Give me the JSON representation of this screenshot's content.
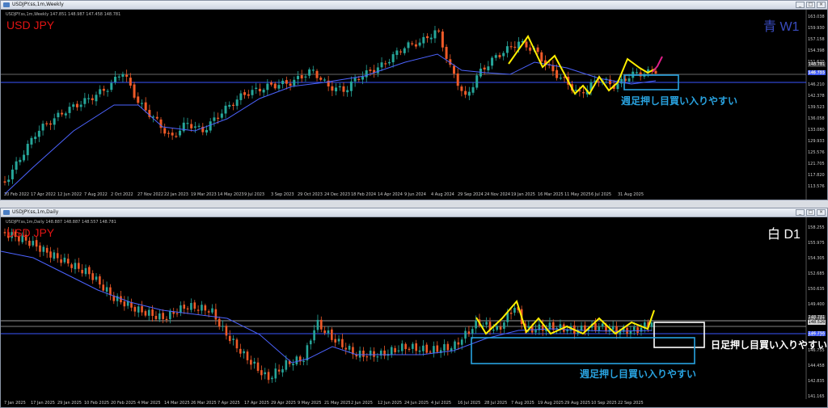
{
  "colors": {
    "bull": "#26a69a",
    "bear": "#ef5a28",
    "ma": "#4c63ff",
    "zigzag": "#ffef00",
    "pink": "#e01f8a",
    "cyan": "#29a3e0",
    "white": "#ffffff",
    "symbol": "#e11414",
    "w1_tag": "#3a4cc0",
    "d1_tag": "#ffffff"
  },
  "weekly": {
    "window_title": "USDJPY.ss,1m,Weekly",
    "header": "USDJPY.ss,1m,Weekly  147.851 148.987 147.458 148.781",
    "symbol": "USD JPY",
    "tag": "青 W1",
    "note": "週足押し目買い入りやすい",
    "price_ticks": [
      "163.038",
      "159.930",
      "157.158",
      "154.398",
      "151.620",
      "148.763",
      "146.210",
      "142.378",
      "139.523",
      "136.058",
      "133.080",
      "129.933",
      "125.576",
      "121.705",
      "117.820",
      "113.576"
    ],
    "price_labels": {
      "current": "148.781",
      "ma": "146.755"
    },
    "time_ticks": [
      "20 Feb 2022",
      "17 Apr 2022",
      "12 Jun 2022",
      "7 Aug 2022",
      "2 Oct 2022",
      "27 Nov 2022",
      "22 Jan 2023",
      "19 Mar 2023",
      "14 May 2023",
      "9 Jul 2023",
      "3 Sep 2023",
      "29 Oct 2023",
      "24 Dec 2023",
      "18 Feb 2024",
      "14 Apr 2024",
      "9 Jun 2024",
      "4 Aug 2024",
      "29 Sep 2024",
      "24 Nov 2024",
      "19 Jan 2025",
      "16 Mar 2025",
      "11 May 2025",
      "6 Jul 2025",
      "31 Aug 2025"
    ]
  },
  "daily": {
    "window_title": "USDJPY.ss,1m,Daily",
    "header": "USDJPY.ss,1m,Daily  148.887 148.887 148.557 148.781",
    "symbol": "USD JPY",
    "tag": "白 D1",
    "note_daily": "日足押し目買い入りやすい",
    "note_weekly": "週足押し目買い入りやすい",
    "price_ticks": [
      "158.255",
      "155.975",
      "154.305",
      "152.685",
      "150.635",
      "149.400",
      "148.781",
      "147.725",
      "146.755",
      "144.458",
      "142.835",
      "141.165"
    ],
    "price_labels": {
      "current": "148.781",
      "other": "148.526",
      "ma": "146.755"
    },
    "time_ticks": [
      "7 Jan 2025",
      "17 Jan 2025",
      "29 Jan 2025",
      "10 Feb 2025",
      "20 Feb 2025",
      "4 Mar 2025",
      "14 Mar 2025",
      "26 Mar 2025",
      "7 Apr 2025",
      "17 Apr 2025",
      "29 Apr 2025",
      "9 May 2025",
      "21 May 2025",
      "2 Jun 2025",
      "12 Jun 2025",
      "24 Jun 2025",
      "4 Jul 2025",
      "16 Jul 2025",
      "28 Jul 2025",
      "7 Aug 2025",
      "19 Aug 2025",
      "29 Aug 2025",
      "10 Sep 2025",
      "22 Sep 2025"
    ]
  }
}
